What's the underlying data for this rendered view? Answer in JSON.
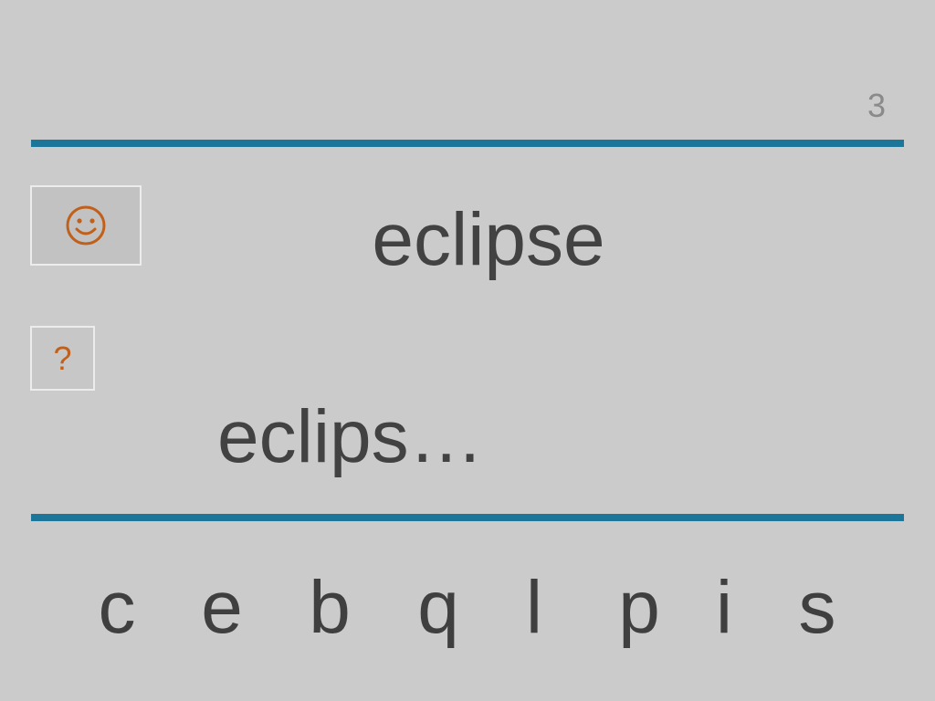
{
  "progress": {
    "counter": "3"
  },
  "colors": {
    "background": "#cbcbcb",
    "rule": "#1b7699",
    "text": "#424242",
    "accent": "#c0601a",
    "counter": "#8a8a8a"
  },
  "buttons": {
    "hint_icon": "smiley-icon",
    "help_label": "?"
  },
  "prompt": {
    "word": "eclipse"
  },
  "answer": {
    "text": "eclips…"
  },
  "letter_choices": [
    "c",
    "e",
    "b",
    "q",
    "l",
    "p",
    "i",
    "s"
  ]
}
